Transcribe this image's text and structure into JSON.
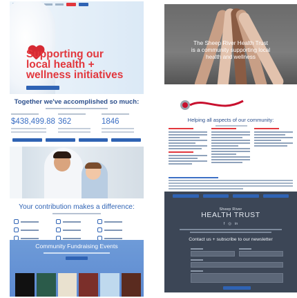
{
  "hero": {
    "headline": [
      "Supporting our",
      "local health +",
      "wellness initiatives"
    ],
    "colors": {
      "accent": "#e2373d",
      "primary": "#2f63b4"
    }
  },
  "accomplished": {
    "title": "Together we've accomplished so much:",
    "stats": [
      {
        "value": "$438,499.88"
      },
      {
        "value": "362"
      },
      {
        "value": "1846"
      }
    ]
  },
  "contribution": {
    "title": "Your contribution makes a difference:"
  },
  "events": {
    "title": "Community Fundraising Events"
  },
  "hands_panel": {
    "caption": [
      "The Sheep River Health Trust",
      "is a community supporting local",
      "health and wellness"
    ]
  },
  "help": {
    "title": "Helping all aspects of our community:"
  },
  "footer": {
    "brand_line1": "Sheep River",
    "brand_line2": "HEALTH TRUST",
    "social": [
      "f",
      "◎",
      "in"
    ],
    "newsletter_title": "Contact us + subscribe to our newsletter"
  },
  "icons": [
    "heart-icon",
    "stethoscope-icon",
    "facebook-icon",
    "instagram-icon",
    "linkedin-icon"
  ]
}
